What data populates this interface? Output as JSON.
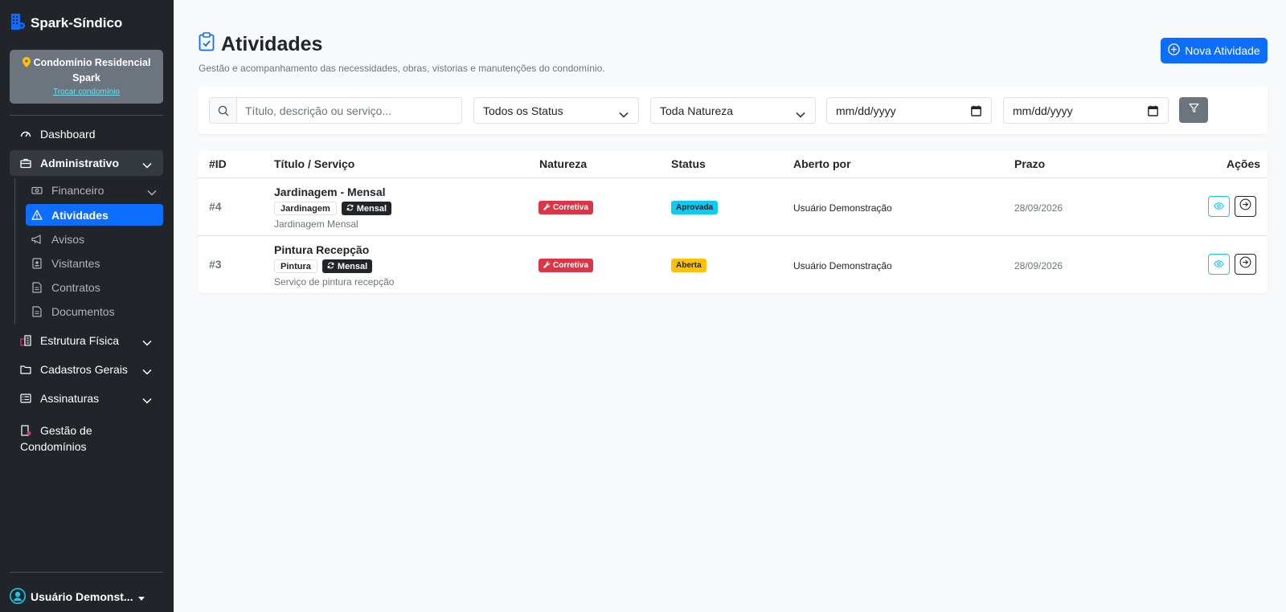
{
  "app": {
    "brand": "Spark-Síndico"
  },
  "condo": {
    "name": "Condomínio Residencial Spark",
    "switch_label": "Trocar condomínio"
  },
  "sidebar": {
    "dashboard": "Dashboard",
    "administrativo": "Administrativo",
    "sub_items": [
      "Financeiro",
      "Atividades",
      "Avisos",
      "Visitantes",
      "Contratos",
      "Documentos"
    ],
    "estrutura": "Estrutura Física",
    "cadastros": "Cadastros Gerais",
    "assinaturas": "Assinaturas",
    "gestao": "Gestão de Condomínios",
    "user": "Usuário Demonst..."
  },
  "page": {
    "title": "Atividades",
    "subtitle": "Gestão e acompanhamento das necessidades, obras, vistorias e manutenções do condomínio.",
    "new_button": "Nova Atividade"
  },
  "filters": {
    "search_placeholder": "Título, descrição ou serviço...",
    "status_value": "Todos os Status",
    "natureza_value": "Toda Natureza",
    "date_from": "mm/dd/yyyy",
    "date_to": "mm/dd/yyyy"
  },
  "table": {
    "headers": [
      "#ID",
      "Título / Serviço",
      "Natureza",
      "Status",
      "Aberto por",
      "Prazo",
      "Ações"
    ],
    "rows": [
      {
        "id": "#4",
        "title": "Jardinagem - Mensal",
        "category": "Jardinagem",
        "recurrence": "Mensal",
        "description": "Jardinagem Mensal",
        "nature": "Corretiva",
        "status": "Aprovada",
        "opened_by": "Usuário Demonstração",
        "deadline": "28/09/2026"
      },
      {
        "id": "#3",
        "title": "Pintura Recepção",
        "category": "Pintura",
        "recurrence": "Mensal",
        "description": "Serviço de pintura recepção",
        "nature": "Corretiva",
        "status": "Aberta",
        "opened_by": "Usuário Demonstração",
        "deadline": "28/09/2026"
      }
    ]
  },
  "colors": {
    "sidebar_bg": "#212529",
    "primary": "#0d6efd",
    "danger": "#dc3545",
    "info": "#0dcaf0",
    "warning": "#ffc107",
    "secondary": "#6c757d"
  }
}
